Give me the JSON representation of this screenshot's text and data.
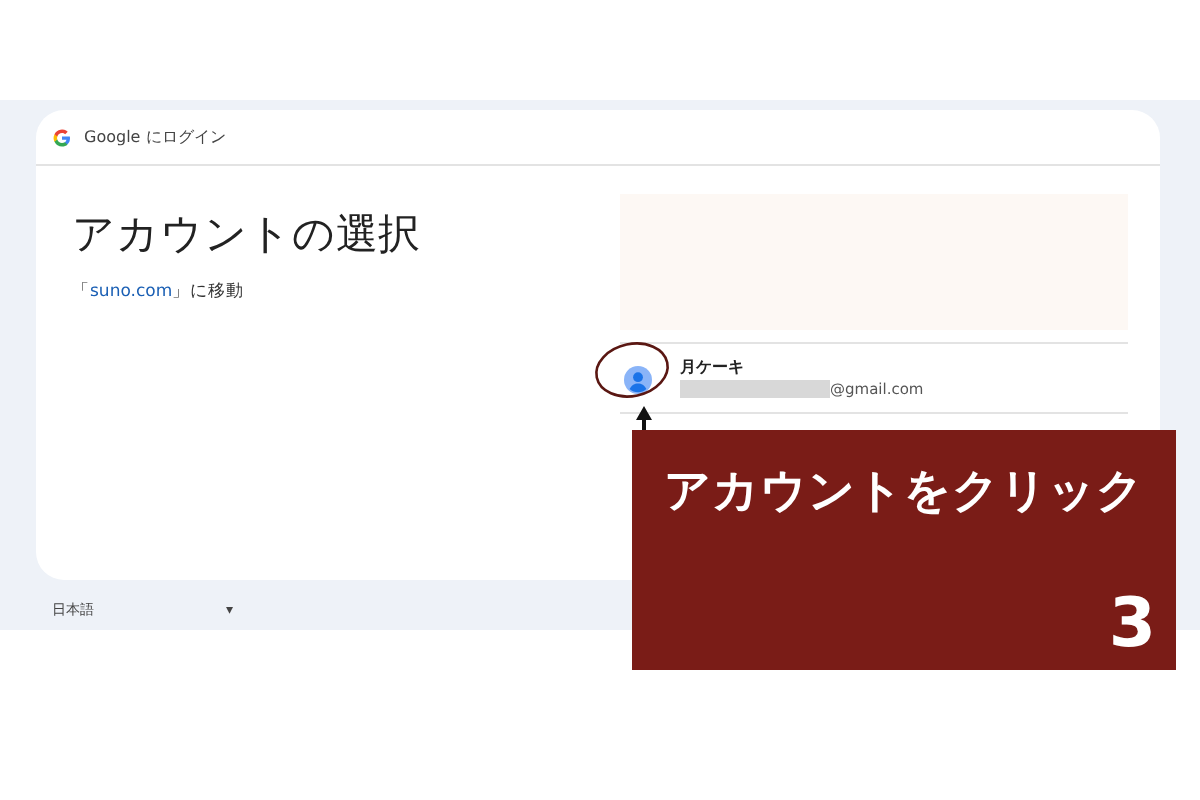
{
  "header": {
    "title": "Google にログイン"
  },
  "heading": "アカウントの選択",
  "subtitle": {
    "prefix": "「",
    "link": "suno.com",
    "suffix": "」に移動"
  },
  "accounts": [
    {
      "name": "月ケーキ",
      "email": "@gmail.com"
    }
  ],
  "footer": {
    "language": "日本語",
    "dropdown": "▾"
  },
  "annotation": {
    "caption": "アカウントをクリック",
    "step": "3"
  }
}
